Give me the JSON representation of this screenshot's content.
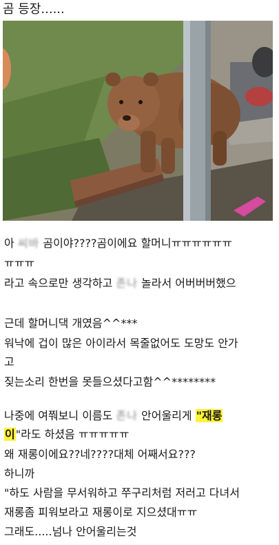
{
  "post": {
    "title": "곰 등장......",
    "photo_icon": "brown-dog-photo",
    "colors": {
      "highlight": "#fff23a",
      "text": "#1a1a1a"
    },
    "lines": {
      "l1a": "아 ",
      "l1blur": "씨바",
      "l1b": " 곰이야????곰이에요 할머니ㅠㅠㅠㅠㅠㅠ",
      "l2": "ㅠㅠㅠ",
      "l3a": "라고 속으로만 생각하고 ",
      "l3blur": "존나",
      "l3b": " 놀라서 어버버버했으",
      "l4": "근데 할머니댁 개였음^^***",
      "l5": "워낙에 겁이 많은 아이라서 목줄없어도 도망도 안가",
      "l6": "고",
      "l7": "짖는소리 한번을 못들으셨다고함^^********",
      "l8a": "나중에 여쭤보니 이름도 ",
      "l8blur": "존나",
      "l8b": " 안어울리게 ",
      "l8hl": "\"재롱",
      "l9hl": "이",
      "l9b": "\"라도 하셨음 ㅠㅠㅠㅠㅠ",
      "l10": "왜 재롱이에요??네????대체 어째서요???",
      "l11": "하니까",
      "l12": "\"하도 사람을 무서워하고 쭈구리처럼 저러고 다녀서",
      "l13": "재롱좀 피워보라고 재롱이로 지으셨대ㅠㅠ",
      "l14": "그래도.....넘나 안어울리는것"
    }
  }
}
